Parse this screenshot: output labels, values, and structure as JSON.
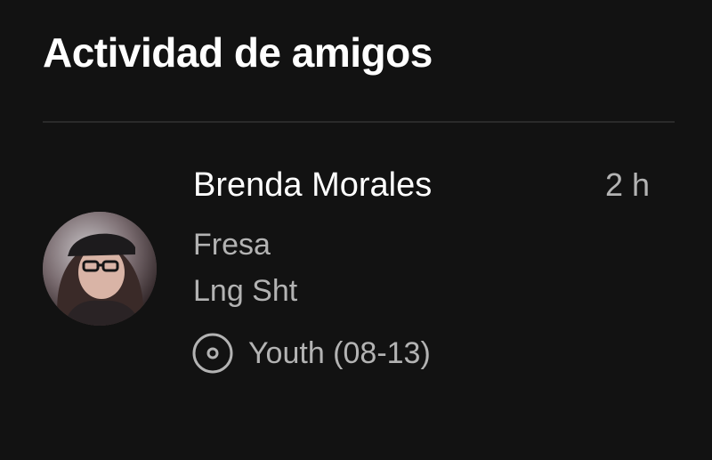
{
  "panel": {
    "title": "Actividad de amigos"
  },
  "friends": [
    {
      "name": "Brenda Morales",
      "time": "2 h",
      "track": "Fresa",
      "artist": "Lng Sht",
      "context_icon": "album-icon",
      "context": "Youth (08-13)"
    }
  ],
  "colors": {
    "background": "#121212",
    "primary_text": "#ffffff",
    "secondary_text": "#b3b3b3",
    "divider": "#2a2a2a"
  }
}
